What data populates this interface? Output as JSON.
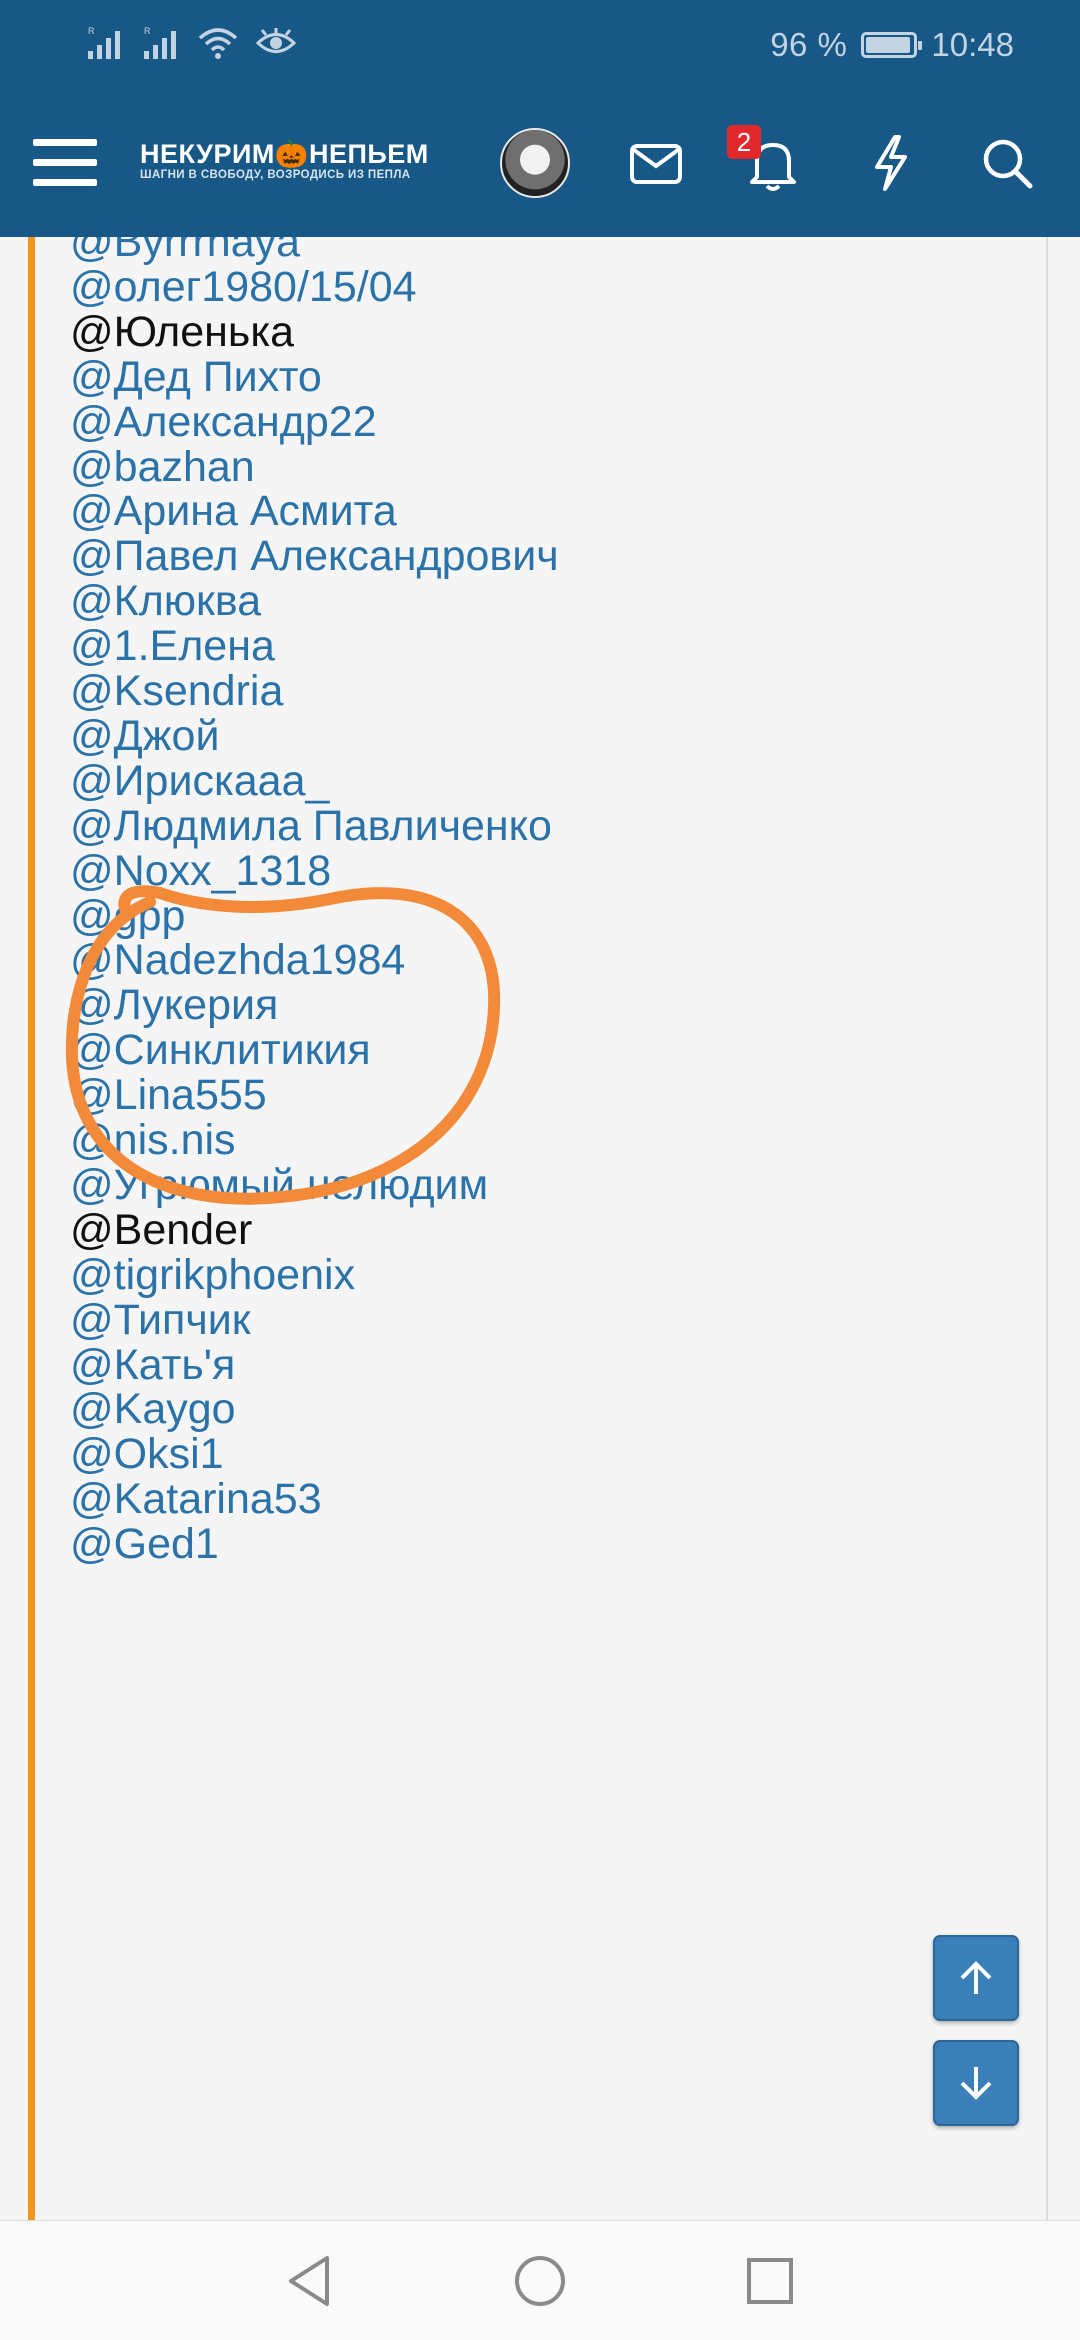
{
  "status_bar": {
    "battery_text": "96 %",
    "battery_level": 0.96,
    "time": "10:48",
    "icons": [
      "signal-1-icon",
      "signal-2-icon",
      "wifi-icon",
      "eye-comfort-icon",
      "battery-icon"
    ]
  },
  "header": {
    "logo_main": "НЕКУРИМ🎃НЕПЬЕМ",
    "logo_sub": "ШАГНИ В СВОБОДУ, ВОЗРОДИСЬ ИЗ ПЕПЛА",
    "notification_count": "2",
    "icons": [
      "menu-icon",
      "avatar",
      "mail-icon",
      "bell-icon",
      "bolt-icon",
      "search-icon"
    ],
    "bar_color": "#185886"
  },
  "mentions": [
    {
      "text": "@Byrrrnaya",
      "style": "link"
    },
    {
      "text": "@олег1980/15/04",
      "style": "link"
    },
    {
      "text": "@Юленька",
      "style": "plain"
    },
    {
      "text": "@Дед Пихто",
      "style": "link"
    },
    {
      "text": "@Александр22",
      "style": "link"
    },
    {
      "text": "@bazhan",
      "style": "link"
    },
    {
      "text": "@Арина Асмита",
      "style": "link"
    },
    {
      "text": "@Павел Александрович",
      "style": "link"
    },
    {
      "text": "@Клюква",
      "style": "link"
    },
    {
      "text": "@1.Елена",
      "style": "link"
    },
    {
      "text": "@Ksendria",
      "style": "link"
    },
    {
      "text": "@Джой",
      "style": "link"
    },
    {
      "text": "@Ирискааа_",
      "style": "link"
    },
    {
      "text": "@Людмила Павличенко",
      "style": "link"
    },
    {
      "text": "@Noxx_1318",
      "style": "link"
    },
    {
      "text": "@gpp",
      "style": "link"
    },
    {
      "text": "@Nadezhda1984",
      "style": "link"
    },
    {
      "text": "@Лукерия",
      "style": "link"
    },
    {
      "text": "@Синклитикия",
      "style": "link"
    },
    {
      "text": "@Lina555",
      "style": "link"
    },
    {
      "text": "@nis.nis",
      "style": "link"
    },
    {
      "text": "@Угрюмый нелюдим",
      "style": "link"
    },
    {
      "text": "@Bender",
      "style": "plain"
    },
    {
      "text": "@tigrikphoenix",
      "style": "link"
    },
    {
      "text": "@Типчик",
      "style": "link"
    },
    {
      "text": "@Кать'я",
      "style": "link"
    },
    {
      "text": "@Kaygo",
      "style": "link"
    },
    {
      "text": "@Oksi1",
      "style": "link"
    },
    {
      "text": "@Katarina53",
      "style": "link"
    },
    {
      "text": "@Ged1",
      "style": "link"
    }
  ],
  "colors": {
    "link": "#2a72a8",
    "plain_text": "#111111",
    "quote_bar": "#f0961f",
    "annotation_circle": "#f28a3a",
    "badge": "#e0282d"
  },
  "scroll_buttons": {
    "up_icon": "arrow-up-icon",
    "down_icon": "arrow-down-icon"
  },
  "system_nav": {
    "icons": [
      "back-triangle-icon",
      "home-circle-icon",
      "recents-square-icon"
    ]
  }
}
